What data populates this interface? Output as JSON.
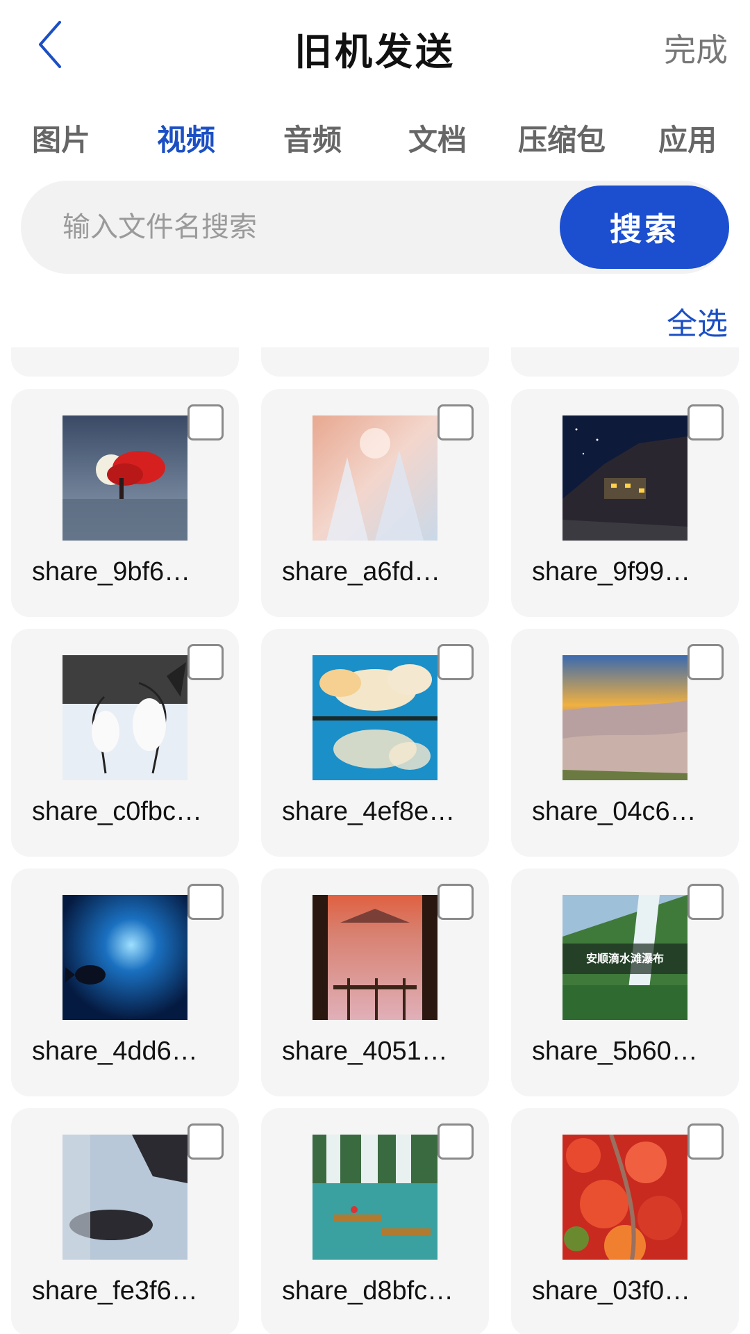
{
  "header": {
    "title": "旧机发送",
    "done_label": "完成"
  },
  "tabs": [
    {
      "label": "图片",
      "active": false
    },
    {
      "label": "视频",
      "active": true
    },
    {
      "label": "音频",
      "active": false
    },
    {
      "label": "文档",
      "active": false
    },
    {
      "label": "压缩包",
      "active": false
    },
    {
      "label": "应用",
      "active": false
    }
  ],
  "search": {
    "placeholder": "输入文件名搜索",
    "button_label": "搜索"
  },
  "select_all_label": "全选",
  "files": [
    {
      "name": "share_9bf6…",
      "icon": "moon-red-tree-thumbnail",
      "checked": false
    },
    {
      "name": "share_a6fd…",
      "icon": "frosted-trees-thumbnail",
      "checked": false
    },
    {
      "name": "share_9f99…",
      "icon": "night-village-thumbnail",
      "checked": false
    },
    {
      "name": "share_c0fbc…",
      "icon": "cranes-snow-thumbnail",
      "checked": false
    },
    {
      "name": "share_4ef8e…",
      "icon": "clouds-reflection-thumbnail",
      "checked": false
    },
    {
      "name": "share_04c6…",
      "icon": "grassland-sunset-thumbnail",
      "checked": false
    },
    {
      "name": "share_4dd6…",
      "icon": "underwater-fish-thumbnail",
      "checked": false
    },
    {
      "name": "share_4051…",
      "icon": "flower-field-window-thumbnail",
      "checked": false
    },
    {
      "name": "share_5b60…",
      "icon": "waterfall-thumbnail",
      "checked": false,
      "overlay_text": "安顺滴水滩瀑布"
    },
    {
      "name": "share_fe3f6…",
      "icon": "car-interior-thumbnail",
      "checked": false
    },
    {
      "name": "share_d8bfc…",
      "icon": "waterfall-boats-thumbnail",
      "checked": false
    },
    {
      "name": "share_03f0…",
      "icon": "red-autumn-hill-thumbnail",
      "checked": false
    }
  ],
  "colors": {
    "accent": "#1b4fc4",
    "button": "#1b4fd0",
    "card_bg": "#f5f5f5"
  }
}
